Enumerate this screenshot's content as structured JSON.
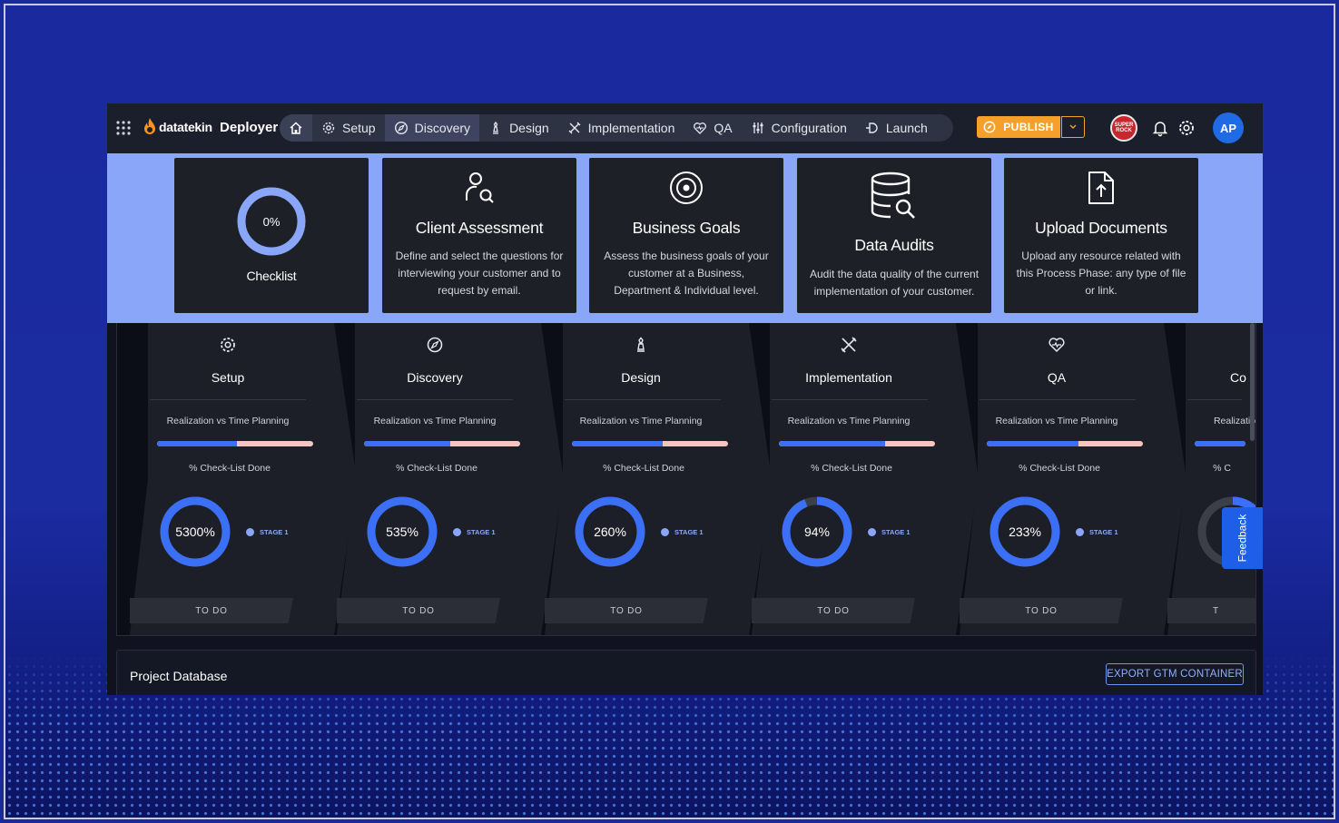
{
  "brand": {
    "logo_text": "datatekin",
    "product": "Deployer"
  },
  "nav": {
    "items": [
      {
        "label": "",
        "icon": "home-icon"
      },
      {
        "label": "Setup",
        "icon": "gear-icon"
      },
      {
        "label": "Discovery",
        "icon": "compass-icon"
      },
      {
        "label": "Design",
        "icon": "chess-piece-icon"
      },
      {
        "label": "Implementation",
        "icon": "tools-icon"
      },
      {
        "label": "QA",
        "icon": "heart-pulse-icon"
      },
      {
        "label": "Configuration",
        "icon": "sliders-icon"
      },
      {
        "label": "Launch",
        "icon": "launch-icon"
      }
    ],
    "active_item": "Discovery",
    "publish_label": "PUBLISH",
    "badge_text": "SUPER ROCK",
    "avatar_initials": "AP"
  },
  "phase_cards": [
    {
      "type": "checklist",
      "title": "Checklist",
      "progress_label": "0%",
      "progress_value": 0
    },
    {
      "title": "Client Assessment",
      "icon": "user-search-icon",
      "description": "Define and select the questions for interviewing your customer and to request  by email."
    },
    {
      "title": "Business Goals",
      "icon": "target-icon",
      "description": "Assess the business goals of your customer at a  Business, Department & Individual level."
    },
    {
      "title": "Data Audits",
      "icon": "database-search-icon",
      "description": "Audit the data quality of the current implementation of your customer."
    },
    {
      "title": "Upload Documents",
      "icon": "file-upload-icon",
      "description": "Upload any resource related with this  Process  Phase: any type of file or link."
    }
  ],
  "stages": [
    {
      "name": "Setup",
      "icon": "gear-icon",
      "planning_label": "Realization vs Time  Planning",
      "planning_fraction": 0.51,
      "checklist_label": "% Check-List  Done",
      "percent_label": "5300%",
      "percent_value": 5300,
      "legend": "STAGE 1",
      "status": "TO DO"
    },
    {
      "name": "Discovery",
      "icon": "compass-icon",
      "planning_label": "Realization vs Time  Planning",
      "planning_fraction": 0.55,
      "checklist_label": "% Check-List  Done",
      "percent_label": "535%",
      "percent_value": 535,
      "legend": "STAGE 1",
      "status": "TO DO"
    },
    {
      "name": "Design",
      "icon": "chess-piece-icon",
      "planning_label": "Realization vs Time  Planning",
      "planning_fraction": 0.58,
      "checklist_label": "% Check-List  Done",
      "percent_label": "260%",
      "percent_value": 260,
      "legend": "STAGE 1",
      "status": "TO DO"
    },
    {
      "name": "Implementation",
      "icon": "tools-icon",
      "planning_label": "Realization vs Time  Planning",
      "planning_fraction": 0.68,
      "checklist_label": "% Check-List  Done",
      "percent_label": "94%",
      "percent_value": 94,
      "legend": "STAGE 1",
      "status": "TO DO"
    },
    {
      "name": "QA",
      "icon": "heart-pulse-icon",
      "planning_label": "Realization vs Time  Planning",
      "planning_fraction": 0.59,
      "checklist_label": "% Check-List  Done",
      "percent_label": "233%",
      "percent_value": 233,
      "legend": "STAGE 1",
      "status": "TO DO"
    },
    {
      "name": "Co",
      "icon": "",
      "planning_label": "Realizatio",
      "planning_fraction": 1.0,
      "checklist_label": "% C",
      "percent_label": "",
      "percent_value": 30,
      "legend": "",
      "status": "T"
    }
  ],
  "feedback_label": "Feedback",
  "project_db": {
    "title": "Project Database",
    "export_label": "EXPORT GTM CONTAINER"
  },
  "colors": {
    "accent": "#3b6ff5",
    "band": "#8aa6f8",
    "publish": "#f5a02b",
    "avatar": "#1f6be5"
  }
}
